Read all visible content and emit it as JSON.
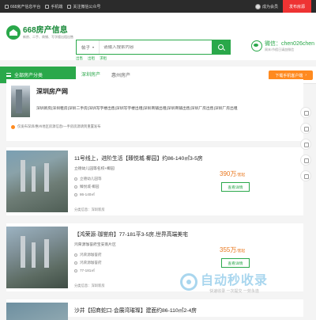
{
  "topbar": {
    "items": [
      "668房产信息平台",
      "手机端",
      "关注微信公众号"
    ],
    "user": "成为会员",
    "publish": "发布房源"
  },
  "header": {
    "logo_title": "668房产信息",
    "logo_sub": "新房、二手、商铺、写字楼出租出售",
    "search_category": "帖子",
    "search_placeholder": "请输入搜索内容",
    "hot_words": [
      "出售",
      "出租",
      "求租"
    ],
    "wechat_label": "微信：chen026chen",
    "wechat_sub": "周末/节假日请加微信"
  },
  "nav": {
    "category_label": "全部房产分类",
    "items": [
      "深圳房产",
      "惠州房产"
    ],
    "cta": "下载手机客户端"
  },
  "intro": {
    "title": "深圳房产网",
    "links": "深圳新房|深圳租房|深圳二手房|深圳写字楼出售|深圳写字楼出租|深圳商铺出租|深圳商铺出售|深圳厂房出售|深圳厂房出租",
    "notice": "仅发布深圳/惠州地区房源信息!一手房房源请到重置发布"
  },
  "listings": [
    {
      "title": "11号线上，进阶生活【臻悦城·椰园】约86-140㎡3-5房",
      "sub": "立德幼儿园等名校+椰园",
      "meta1": "立德幼儿园等",
      "meta2": "臻悦城·椰园",
      "meta3": "86-140㎡",
      "tag": "分类信息：深圳新房",
      "price": "390万",
      "price_unit": "/套起",
      "button": "查看详情"
    },
    {
      "title": "【鸿荣源·珈誉府】77-181平3-5房,世界高端美宅",
      "sub": "鸿荣源珈誉府宝安南片区",
      "meta1": "鸿荣源珈誉府",
      "meta2": "鸿荣源珈誉府",
      "meta3": "77-181㎡",
      "tag": "分类信息：深圳新房",
      "price": "355万",
      "price_unit": "/套起",
      "button": "查看详情"
    },
    {
      "title": "沙井【招商蛇口·会展湾璀璨】建面约86-110㎡2-4房",
      "sub": "",
      "meta1": "",
      "meta2": "",
      "meta3": "",
      "tag": "",
      "price": "",
      "price_unit": "",
      "button": ""
    }
  ],
  "watermark": {
    "title": "自动秒收录",
    "sub": "快速收录 一次提交 一劳永逸"
  },
  "colors": {
    "brand": "#2aa84a",
    "accent": "#ff8a1f",
    "price": "#e9781f"
  }
}
